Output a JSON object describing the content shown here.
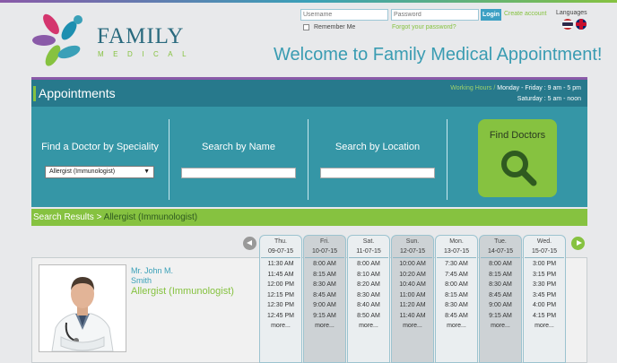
{
  "brand": {
    "name": "FAMILY",
    "sub": "MEDICAL"
  },
  "login": {
    "username_placeholder": "Username",
    "password_placeholder": "Password",
    "login_label": "Login",
    "create_account": "Create account",
    "remember_me": "Remember Me",
    "forgot_password": "Forgot your password?"
  },
  "languages": {
    "label": "Languages",
    "options": [
      "Thai",
      "English"
    ]
  },
  "welcome": "Welcome to Family Medical Appointment!",
  "appointments": {
    "title": "Appointments",
    "hours_label": "Working Hours /",
    "hours_weekday": "Monday - Friday : 9 am - 5 pm",
    "hours_saturday": "Saturday : 5 am - noon"
  },
  "search": {
    "speciality_label": "Find a Doctor by Speciality",
    "speciality_value": "Allergist (Immunologist)",
    "name_label": "Search by Name",
    "location_label": "Search by Location",
    "find_label": "Find Doctors"
  },
  "results": {
    "label": "Search Results >",
    "crumb": " Allergist (Immunologist)"
  },
  "doctor": {
    "first": "Mr. John M.",
    "last": "Smith",
    "speciality": "Allergist (Immunologist)"
  },
  "schedule": [
    {
      "day": "Thu.",
      "date": "09-07-15",
      "times": [
        "11:30 AM",
        "11:45 AM",
        "12:00 PM",
        "12:15 PM",
        "12:30 PM",
        "12:45 PM"
      ],
      "more": "more..."
    },
    {
      "day": "Fri.",
      "date": "10-07-15",
      "times": [
        "8:00 AM",
        "8:15 AM",
        "8:30 AM",
        "8:45 AM",
        "9:00 AM",
        "9:15 AM"
      ],
      "more": "more..."
    },
    {
      "day": "Sat.",
      "date": "11-07-15",
      "times": [
        "8:00 AM",
        "8:10 AM",
        "8:20 AM",
        "8:30 AM",
        "8:40 AM",
        "8:50 AM"
      ],
      "more": "more..."
    },
    {
      "day": "Sun.",
      "date": "12-07-15",
      "times": [
        "10:00 AM",
        "10:20 AM",
        "10:40 AM",
        "11:00 AM",
        "11:20 AM",
        "11:40 AM"
      ],
      "more": "more..."
    },
    {
      "day": "Mon.",
      "date": "13-07-15",
      "times": [
        "7:30 AM",
        "7:45 AM",
        "8:00 AM",
        "8:15 AM",
        "8:30 AM",
        "8:45 AM"
      ],
      "more": "more..."
    },
    {
      "day": "Tue.",
      "date": "14-07-15",
      "times": [
        "8:00 AM",
        "8:15 AM",
        "8:30 AM",
        "8:45 AM",
        "9:00 AM",
        "9:15 AM"
      ],
      "more": "more..."
    },
    {
      "day": "Wed.",
      "date": "15-07-15",
      "times": [
        "3:00 PM",
        "3:15 PM",
        "3:30 PM",
        "3:45 PM",
        "4:00 PM",
        "4:15 PM"
      ],
      "more": "more..."
    }
  ],
  "colors": {
    "teal": "#3596a6",
    "dark_teal": "#27798c",
    "green": "#86c240",
    "purple": "#8a5aa8"
  }
}
